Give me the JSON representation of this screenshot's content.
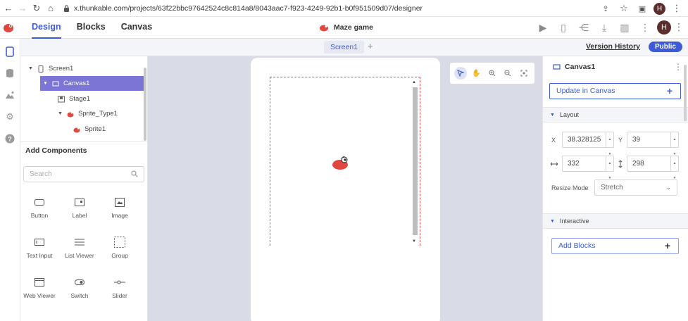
{
  "browser": {
    "url": "x.thunkable.com/projects/63f22bbc97642524c8c814a8/8043aac7-f923-4249-92b1-b0f951509d07/designer",
    "avatar_letter": "H"
  },
  "header": {
    "tabs": [
      {
        "label": "Design",
        "active": true
      },
      {
        "label": "Blocks",
        "active": false
      },
      {
        "label": "Canvas",
        "active": false
      }
    ],
    "project_name": "Maze game",
    "avatar_letter": "H"
  },
  "screenbar": {
    "screen_tab": "Screen1",
    "add_label": "+",
    "version_history": "Version History",
    "public_label": "Public"
  },
  "tree": {
    "items": [
      {
        "label": "Screen1",
        "level": 0,
        "selected": false,
        "icon": "phone-icon"
      },
      {
        "label": "Canvas1",
        "level": 1,
        "selected": true,
        "icon": "canvas-icon"
      },
      {
        "label": "Stage1",
        "level": 2,
        "selected": false,
        "icon": "stage-icon"
      },
      {
        "label": "Sprite_Type1",
        "level": 2,
        "selected": false,
        "icon": "sprite-icon"
      },
      {
        "label": "Sprite1",
        "level": 3,
        "selected": false,
        "icon": "sprite-icon"
      }
    ]
  },
  "components": {
    "title": "Add Components",
    "search_placeholder": "Search",
    "items": [
      {
        "label": "Button",
        "icon": "button-icon"
      },
      {
        "label": "Label",
        "icon": "label-icon"
      },
      {
        "label": "Image",
        "icon": "image-icon"
      },
      {
        "label": "Text Input",
        "icon": "text-input-icon"
      },
      {
        "label": "List Viewer",
        "icon": "list-viewer-icon"
      },
      {
        "label": "Group",
        "icon": "group-icon"
      },
      {
        "label": "Web Viewer",
        "icon": "web-viewer-icon"
      },
      {
        "label": "Switch",
        "icon": "switch-icon"
      },
      {
        "label": "Slider",
        "icon": "slider-icon"
      }
    ]
  },
  "properties": {
    "title": "Canvas1",
    "update_label": "Update in Canvas",
    "layout_section": "Layout",
    "x_label": "X",
    "x_value": "38.328125",
    "y_label": "Y",
    "y_value": "39",
    "width_value": "332",
    "height_value": "298",
    "resize_label": "Resize Mode",
    "resize_value": "Stretch",
    "interactive_section": "Interactive",
    "add_blocks_label": "Add Blocks"
  },
  "colors": {
    "accent": "#3d5bd6",
    "selected_row": "#7b76d6",
    "sprite_red": "#e0473f"
  }
}
